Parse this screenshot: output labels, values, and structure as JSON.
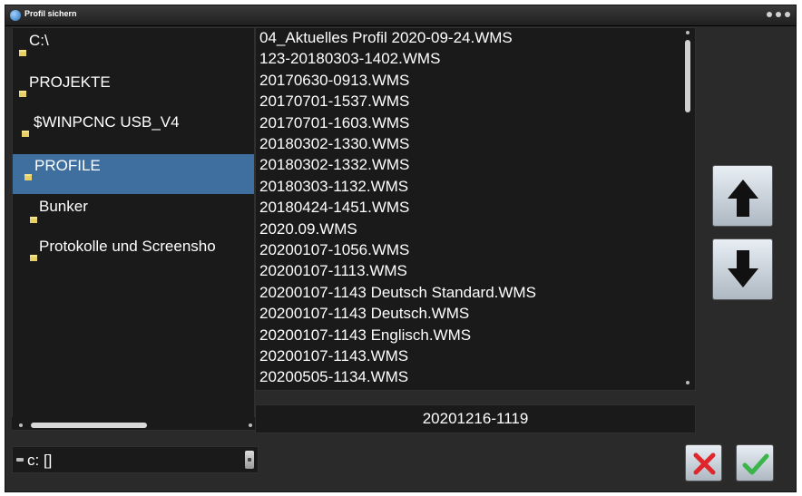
{
  "window": {
    "title": "Profil sichern"
  },
  "tree": {
    "items": [
      {
        "label": "C:\\",
        "selected": false
      },
      {
        "label": "PROJEKTE",
        "selected": false
      },
      {
        "label": "$WINPCNC USB_V4",
        "selected": false
      },
      {
        "label": "PROFILE",
        "selected": true
      },
      {
        "label": "Bunker",
        "selected": false
      },
      {
        "label": "Protokolle und Screensho",
        "selected": false
      }
    ]
  },
  "files": [
    "04_Aktuelles Profil 2020-09-24.WMS",
    "123-20180303-1402.WMS",
    "20170630-0913.WMS",
    "20170701-1537.WMS",
    "20170701-1603.WMS",
    "20180302-1330.WMS",
    "20180302-1332.WMS",
    "20180303-1132.WMS",
    "20180424-1451.WMS",
    "2020.09.WMS",
    "20200107-1056.WMS",
    "20200107-1113.WMS",
    "20200107-1143 Deutsch Standard.WMS",
    "20200107-1143 Deutsch.WMS",
    "20200107-1143 Englisch.WMS",
    "20200107-1143.WMS",
    "20200505-1134.WMS"
  ],
  "filename": {
    "value": "20201216-1119"
  },
  "drive": {
    "value": "c: []"
  },
  "colors": {
    "selection": "#3f6f9e",
    "cancel": "#e0262b",
    "ok": "#3bb54a"
  },
  "icons": {
    "up": "arrow-up-icon",
    "down": "arrow-down-icon",
    "cancel": "x-icon",
    "ok": "checkmark-icon"
  }
}
